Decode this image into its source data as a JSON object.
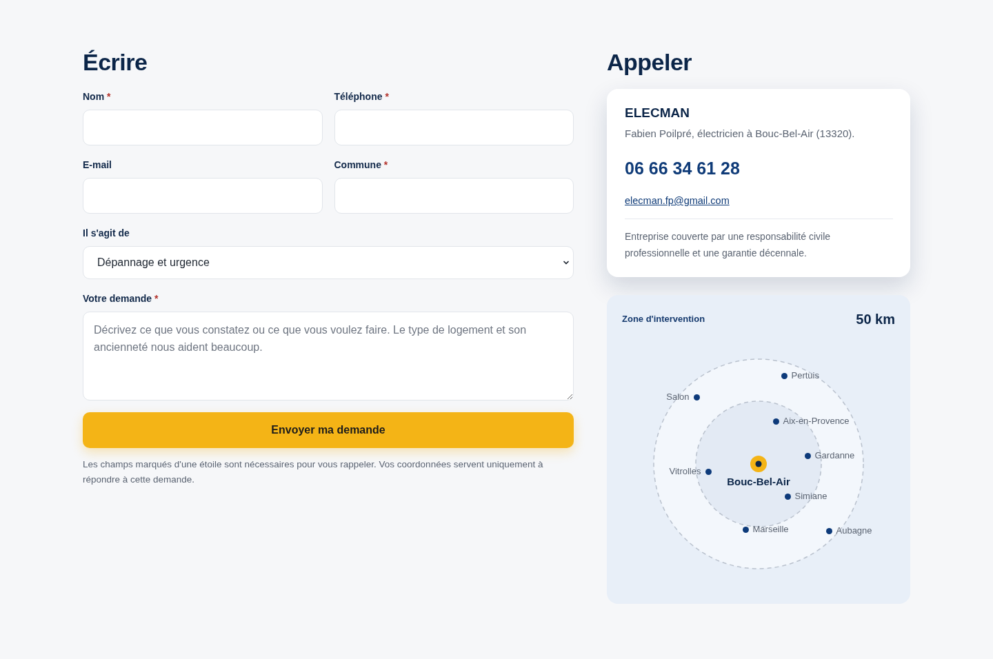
{
  "form": {
    "title": "Écrire",
    "fields": [
      {
        "kind": "input",
        "label": "Nom",
        "required_mark": "*"
      },
      {
        "kind": "input",
        "label": "Téléphone",
        "required_mark": "*"
      },
      {
        "kind": "input",
        "label": "E-mail"
      },
      {
        "kind": "input",
        "label": "Commune",
        "required_mark": "*"
      },
      {
        "kind": "select",
        "label": "Il s'agit de",
        "value": "Dépannage et urgence"
      },
      {
        "kind": "textarea",
        "label": "Votre demande",
        "required_mark": "*",
        "placeholder": "Décrivez ce que vous constatez ou ce que vous voulez faire. Le type de logement et son ancienneté nous aident beaucoup."
      }
    ],
    "submit_button": "Envoyer ma demande",
    "note": "Les champs marqués d'une étoile sont nécessaires pour vous rappeler. Vos coordonnées servent uniquement à répondre à cette demande."
  },
  "contact": {
    "title": "Appeler",
    "card": {
      "company": "ELECMAN",
      "description": "Fabien Poilpré, électricien à Bouc-Bel-Air (13320).",
      "phone": "06 66 34 61 28",
      "email": "elecman.fp@gmail.com",
      "insurance": "Entreprise couverte par une responsabilité civile professionnelle et une garantie décennale."
    },
    "zone": {
      "label": "Zone d'intervention",
      "radius": "50 km",
      "center": "Bouc-Bel-Air",
      "cities": [
        {
          "name": "Pertuis"
        },
        {
          "name": "Salon"
        },
        {
          "name": "Aix-en-Provence"
        },
        {
          "name": "Gardanne"
        },
        {
          "name": "Vitrolles"
        },
        {
          "name": "Simiane"
        },
        {
          "name": "Marseille"
        },
        {
          "name": "Aubagne"
        }
      ]
    }
  }
}
